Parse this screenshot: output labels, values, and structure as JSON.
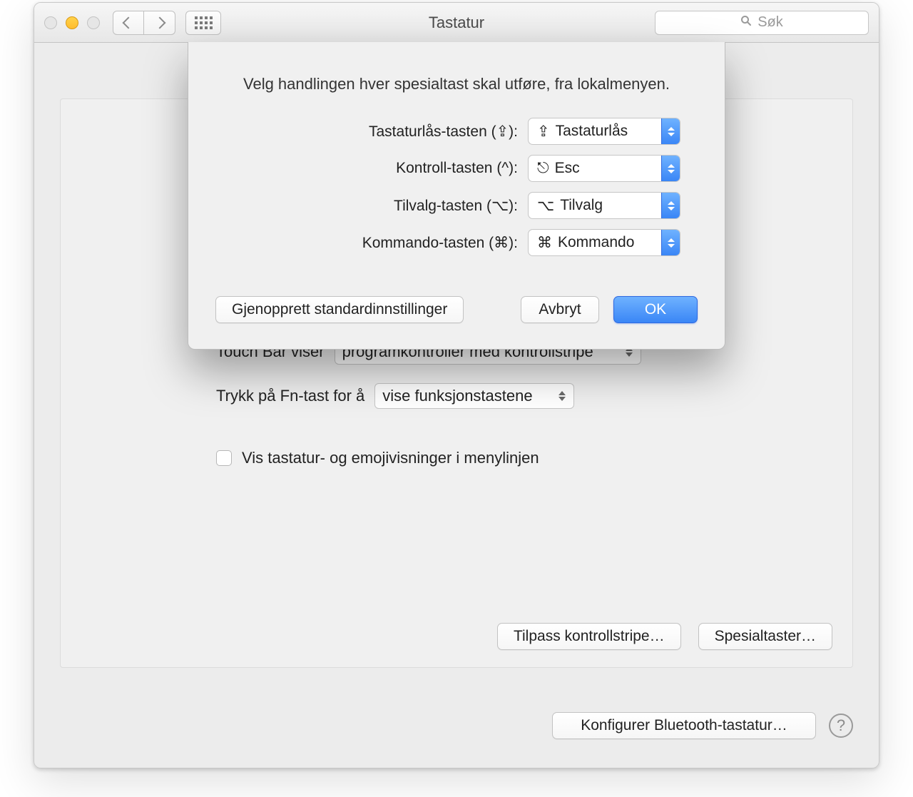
{
  "window": {
    "title": "Tastatur",
    "search_placeholder": "Søk"
  },
  "panel": {
    "touchbar_label": "Touch Bar viser",
    "touchbar_value": "programkontroller med kontrollstripe",
    "fn_label": "Trykk på Fn-tast for å",
    "fn_value": "vise funksjonstastene",
    "checkbox_label": "Vis tastatur- og emojivisninger i menylinjen",
    "btn_customize_strip": "Tilpass kontrollstripe…",
    "btn_modifier_keys": "Spesialtaster…"
  },
  "bottom": {
    "btn_bluetooth": "Konfigurer Bluetooth-tastatur…"
  },
  "sheet": {
    "title": "Velg handlingen hver spesialtast skal utføre, fra lokalmenyen.",
    "rows": [
      {
        "label": "Tastaturlås-tasten (⇪):",
        "icon": "⇪",
        "value": "Tastaturlås"
      },
      {
        "label": "Kontroll-tasten (^):",
        "icon": "⎋",
        "value": "Esc"
      },
      {
        "label": "Tilvalg-tasten (⌥):",
        "icon": "⌥",
        "value": "Tilvalg"
      },
      {
        "label": "Kommando-tasten (⌘):",
        "icon": "⌘",
        "value": "Kommando"
      }
    ],
    "btn_restore": "Gjenopprett standardinnstillinger",
    "btn_cancel": "Avbryt",
    "btn_ok": "OK"
  }
}
